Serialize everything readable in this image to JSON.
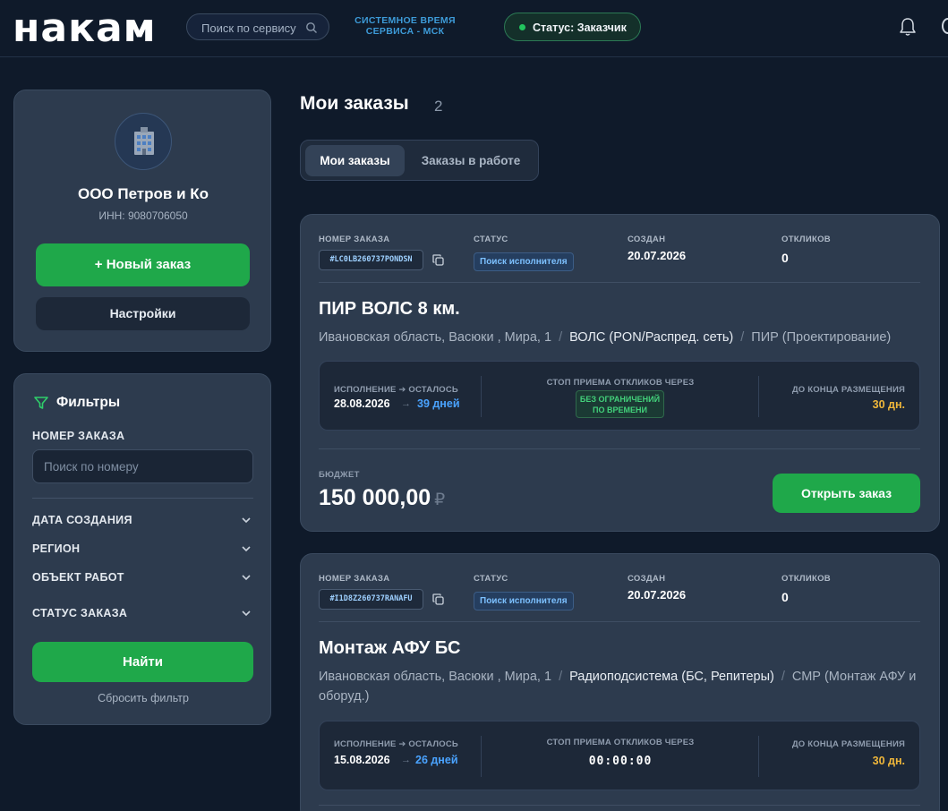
{
  "header": {
    "logo": "накам",
    "search_placeholder": "Поиск по сервису",
    "system_time_line1": "СИСТЕМНОЕ ВРЕМЯ",
    "system_time_line2": "СЕРВИСА - МСК",
    "status_label": "Статус: Заказчик",
    "accent_color": "#22c55e"
  },
  "profile": {
    "avatar_emoji": "🏢",
    "name": "ООО Петров и Ко",
    "inn": "ИНН: 9080706050",
    "new_order_label": "+ Новый заказ",
    "settings_label": "Настройки"
  },
  "filters": {
    "title": "Фильтры",
    "order_number_label": "НОМЕР ЗАКАЗА",
    "order_number_placeholder": "Поиск по номеру",
    "rows": [
      "ДАТА СОЗДАНИЯ",
      "РЕГИОН",
      "ОБЪЕКТ РАБОТ",
      "СТАТУС ЗАКАЗА"
    ],
    "find_label": "Найти",
    "reset_label": "Сбросить фильтр"
  },
  "main": {
    "title": "Мои заказы",
    "count": "2",
    "tabs": [
      {
        "label": "Мои заказы",
        "active": true
      },
      {
        "label": "Заказы в работе",
        "active": false
      }
    ]
  },
  "labels": {
    "order_number": "НОМЕР ЗАКАЗА",
    "status": "СТАТУС",
    "created": "СОЗДАН",
    "responses": "ОТКЛИКОВ",
    "execution": "ИСПОЛНЕНИЕ ➔ ОСТАЛОСЬ",
    "stop": "СТОП ПРИЕМА ОТКЛИКОВ ЧЕРЕЗ",
    "placement": "ДО КОНЦА РАЗМЕЩЕНИЯ",
    "budget": "БЮДЖЕТ",
    "open_order": "Открыть заказ",
    "currency": "₽",
    "arrow": "→"
  },
  "orders": [
    {
      "code": "#LC0LB260737PONDSN",
      "status": "Поиск исполнителя",
      "created": "20.07.2026",
      "responses": "0",
      "title": "ПИР ВОЛС 8 км.",
      "location": "Ивановская область, Васюки , Мира, 1",
      "object": "ВОЛС (PON/Распред. сеть)",
      "work_type": "ПИР (Проектирование)",
      "exec_date": "28.08.2026",
      "days_left": "39 дней",
      "stop_line1": "БЕЗ ОГРАНИЧЕНИЙ",
      "stop_line2": "ПО ВРЕМЕНИ",
      "placement_days": "30 дн.",
      "budget": "150 000,00"
    },
    {
      "code": "#I1D8Z260737RANAFU",
      "status": "Поиск исполнителя",
      "created": "20.07.2026",
      "responses": "0",
      "title": "Монтаж АФУ БС",
      "location": "Ивановская область, Васюки , Мира, 1",
      "object": "Радиоподсистема (БС, Репитеры)",
      "work_type": "СМР (Монтаж АФУ и оборуд.)",
      "exec_date": "15.08.2026",
      "days_left": "26 дней",
      "stop_timer": "00:00:00",
      "placement_days": "30 дн."
    }
  ]
}
